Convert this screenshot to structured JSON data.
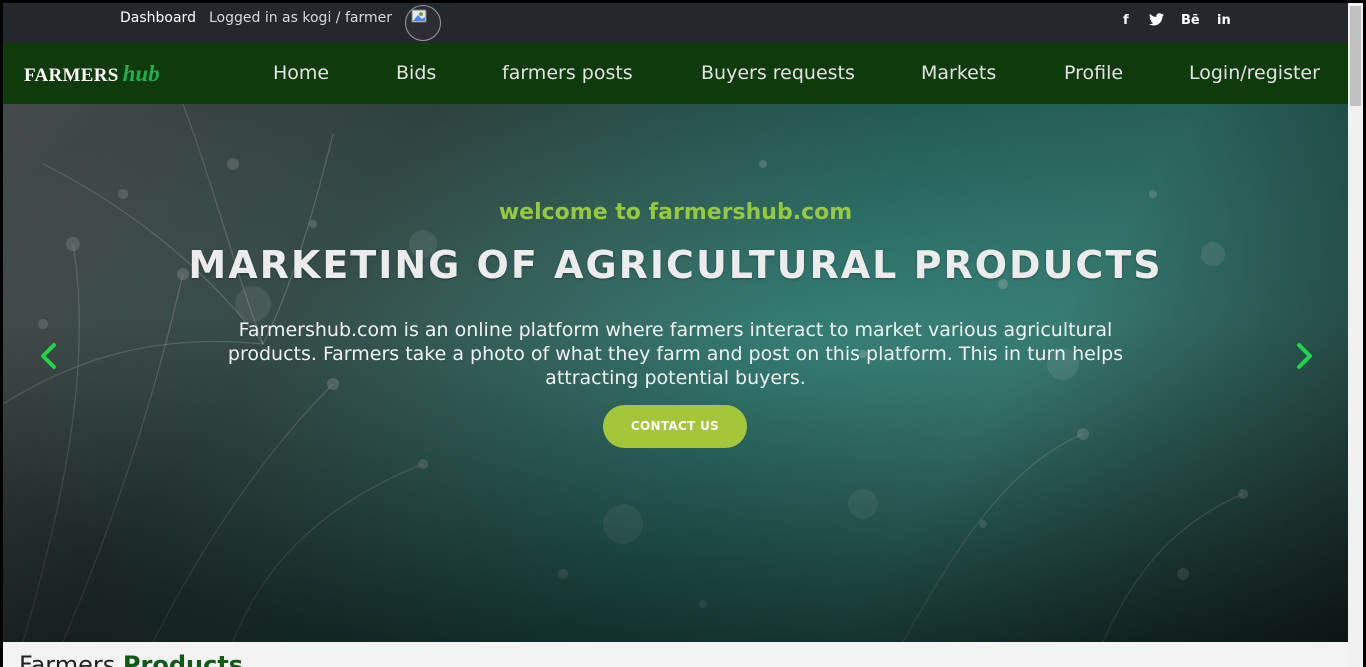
{
  "topbar": {
    "dashboard": "Dashboard",
    "logged_in": "Logged in as kogi / farmer",
    "social": [
      "f",
      "🐦",
      "Bē",
      "in"
    ]
  },
  "brand": {
    "part1": "FARMERS",
    "part2": "hub"
  },
  "nav": [
    "Home",
    "Bids",
    "farmers posts",
    "Buyers requests",
    "Markets",
    "Profile",
    "Login/register"
  ],
  "hero": {
    "welcome": "welcome to farmershub.com",
    "headline": "MARKETING OF AGRICULTURAL PRODUCTS",
    "description": "Farmershub.com is an online platform where farmers interact to market various agricultural products. Farmers take a photo of what they farm and post on this platform. This in turn helps attracting potential buyers.",
    "cta": "CONTACT US"
  },
  "section_peek": {
    "part1": "Farmers ",
    "part2": "Products"
  },
  "colors": {
    "accent": "#96c93d",
    "nav_bg": "#0f3a0b",
    "topbar_bg": "#24282d",
    "arrow": "#1fd64b"
  },
  "icons": {
    "prev": "chevron-left-icon",
    "next": "chevron-right-icon",
    "avatar": "broken-image-icon"
  }
}
